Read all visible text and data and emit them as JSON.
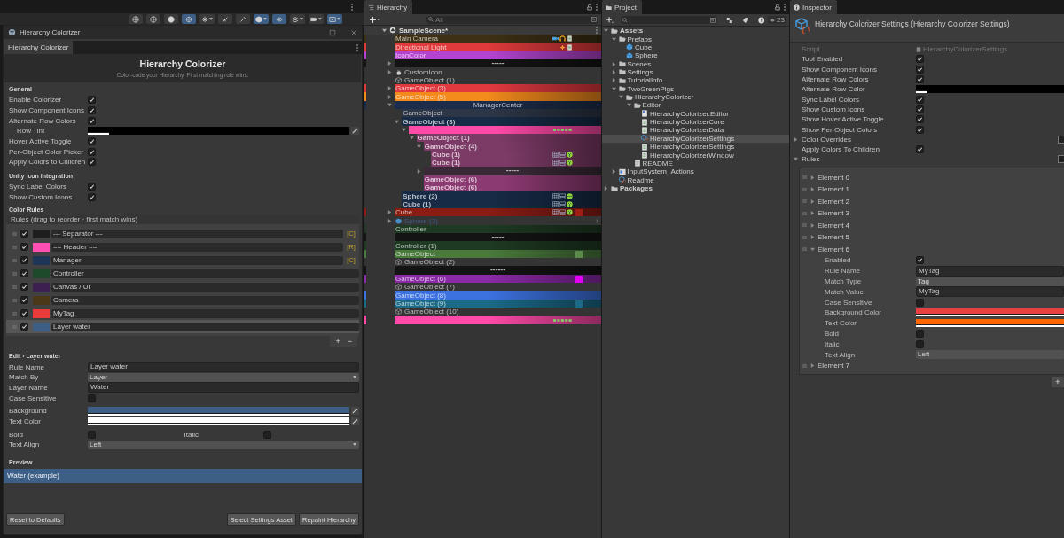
{
  "scene_toolbar": [
    {
      "kind": "wire",
      "selected": false
    },
    {
      "kind": "half",
      "selected": false
    },
    {
      "kind": "solid",
      "selected": false
    },
    {
      "kind": "ring",
      "selected": true
    },
    {
      "kind": "effects",
      "selected": false,
      "dropdown": true
    },
    {
      "kind": "hide",
      "selected": false
    },
    {
      "kind": "tool",
      "selected": false
    },
    {
      "kind": "gizmo",
      "selected": true,
      "dropdown": true
    },
    {
      "kind": "eye",
      "selected": true
    },
    {
      "kind": "layers",
      "selected": false,
      "dropdown": true
    },
    {
      "kind": "camera",
      "selected": false,
      "dropdown": true
    },
    {
      "kind": "overlay",
      "selected": true,
      "dropdown": true
    }
  ],
  "colorizer": {
    "window_title": "Hierarchy Colorizer",
    "tab": "Hierarchy Colorizer",
    "title": "Hierarchy Colorizer",
    "subtitle": "Color-code your Hierarchy. First matching rule wins.",
    "general": {
      "heading": "General",
      "options": [
        {
          "label": "Enable Colorizer",
          "kind": "toggle",
          "checked": true
        },
        {
          "label": "Show Component Icons",
          "kind": "toggle",
          "checked": true
        },
        {
          "label": "Alternate Row Colors",
          "kind": "toggle",
          "checked": true
        },
        {
          "label": "Row Tint",
          "kind": "color",
          "color": "#000000",
          "level": 0.08
        },
        {
          "label": "Hover Active Toggle",
          "kind": "toggle",
          "checked": true
        },
        {
          "label": "Per-Object Color Picker",
          "kind": "toggle",
          "checked": true
        },
        {
          "label": "Apply Colors to Children",
          "kind": "toggle",
          "checked": true
        }
      ]
    },
    "icon_integration": {
      "heading": "Unity Icon Integration",
      "options": [
        {
          "label": "Sync Label Colors",
          "kind": "toggle",
          "checked": true
        },
        {
          "label": "Show Custom Icons",
          "kind": "toggle",
          "checked": true
        }
      ]
    },
    "rules_heading": "Color Rules",
    "rules_header": "Rules  (drag to reorder · first match wins)",
    "rules": [
      {
        "enabled": true,
        "color": "#1e1e1e",
        "name": "--- Separator ---",
        "badge": "[C]",
        "selected": false
      },
      {
        "enabled": true,
        "color": "#ff4fb4",
        "name": "== Header ==",
        "badge": "[R]",
        "selected": false
      },
      {
        "enabled": true,
        "color": "#1f3558",
        "name": "Manager",
        "badge": "[C]",
        "selected": false
      },
      {
        "enabled": true,
        "color": "#1d4a2a",
        "name": "Controller",
        "selected": false
      },
      {
        "enabled": true,
        "color": "#3e1f52",
        "name": "Canvas / UI",
        "selected": false
      },
      {
        "enabled": true,
        "color": "#4a3818",
        "name": "Camera",
        "selected": false
      },
      {
        "enabled": true,
        "color": "#e83c3c",
        "name": "MyTag",
        "selected": false
      },
      {
        "enabled": true,
        "color": "#3d5f86",
        "name": "Layer water",
        "selected": true
      }
    ],
    "add": "+",
    "remove": "−",
    "edit": {
      "heading": "Edit › Layer water",
      "fields": [
        {
          "label": "Rule Name",
          "kind": "text",
          "value": "Layer water"
        },
        {
          "label": "Match By",
          "kind": "dropdown",
          "value": "Layer"
        },
        {
          "label": "Layer Name",
          "kind": "text",
          "value": "Water"
        },
        {
          "label": "Case Sensitive",
          "kind": "toggle",
          "checked": false
        },
        {
          "label": "Background",
          "kind": "color",
          "color": "#3d5f86",
          "level": 1
        },
        {
          "label": "Text Color",
          "kind": "color",
          "color": "#ffffff",
          "level": 1
        },
        {
          "kind": "toggles",
          "items": [
            {
              "label": "Bold",
              "checked": false
            },
            {
              "label": "Italic",
              "checked": false
            }
          ]
        },
        {
          "label": "Text Align",
          "kind": "dropdown",
          "value": "Left"
        }
      ]
    },
    "preview": {
      "heading": "Preview",
      "text": "Water  (example)"
    },
    "buttons": [
      "Reset to Defaults",
      "Select Settings Asset",
      "Repaint Hierarchy"
    ]
  },
  "hierarchy": {
    "tab": "Hierarchy",
    "search": {
      "placeholder": "All"
    },
    "scene": "SampleScene*",
    "rows": [
      {
        "kind": "rule",
        "label": "Main Camera",
        "color": "#3d3014",
        "components": [
          {
            "kind": "camera"
          },
          {
            "kind": "audio"
          },
          {
            "kind": "script"
          }
        ]
      },
      {
        "kind": "rule",
        "label": "Directional Light",
        "color": "#e03a3c",
        "components": [
          {
            "kind": "light"
          },
          {
            "kind": "script"
          }
        ]
      },
      {
        "kind": "rule",
        "label": "IconColor",
        "color": "#b444d0"
      },
      {
        "kind": "separator",
        "label": "-----",
        "color": "#141414",
        "expanded": false
      },
      {
        "kind": "custom",
        "label": "CustomIcon",
        "expanded": false
      },
      {
        "kind": "plain",
        "label": "GameObject (1)"
      },
      {
        "kind": "rule",
        "label": "GameObject (3)",
        "color": "#e2393f",
        "expanded": false
      },
      {
        "kind": "rule",
        "label": "GameObject (5)",
        "color": "#f28a1c",
        "expanded": false
      },
      {
        "kind": "header",
        "label": "ManagerCenter",
        "color": "#1b2d4b",
        "expanded": true,
        "children": [
          {
            "kind": "rule",
            "label": "GameObject",
            "color": "#2d3646"
          },
          {
            "kind": "rule",
            "label": "GameObject (3)",
            "color": "#172b46",
            "bold": true,
            "expanded": true,
            "children": [
              {
                "kind": "header",
                "color": "#ff4aa8",
                "dots": true,
                "expanded": true,
                "children": [
                  {
                    "kind": "rule",
                    "label": "GameObject (1)",
                    "color": "#7c3a66",
                    "bold": true,
                    "expanded": true,
                    "children": [
                      {
                        "kind": "rule",
                        "label": "GameObject (4)",
                        "color": "#7c3a66",
                        "bold": true,
                        "expanded": true,
                        "children": [
                          {
                            "kind": "rule",
                            "label": "Cube (1)",
                            "color": "#7c3a66",
                            "bold": true,
                            "components": [
                              {
                                "kind": "grid"
                              },
                              {
                                "kind": "mesh"
                              },
                              {
                                "kind": "collider"
                              }
                            ]
                          },
                          {
                            "kind": "rule",
                            "label": "Cube (1)",
                            "color": "#7c3a66",
                            "bold": true,
                            "components": [
                              {
                                "kind": "grid"
                              },
                              {
                                "kind": "mesh"
                              },
                              {
                                "kind": "collider"
                              }
                            ]
                          }
                        ]
                      },
                      {
                        "kind": "separator",
                        "label": "-----",
                        "color": "#3a2a38",
                        "expanded": false
                      },
                      {
                        "kind": "rule",
                        "label": "GameObject (6)",
                        "color": "#8c3a72",
                        "bold": true
                      },
                      {
                        "kind": "rule",
                        "label": "GameObject (6)",
                        "color": "#8c3a72",
                        "bold": true
                      }
                    ]
                  }
                ]
              }
            ]
          },
          {
            "kind": "rule",
            "label": "Sphere (2)",
            "color": "#172b46",
            "bold": true,
            "components": [
              {
                "kind": "grid"
              },
              {
                "kind": "mesh"
              },
              {
                "kind": "sphere"
              }
            ]
          },
          {
            "kind": "rule",
            "label": "Cube (1)",
            "color": "#172b46",
            "bold": true,
            "components": [
              {
                "kind": "grid"
              },
              {
                "kind": "mesh"
              },
              {
                "kind": "collider"
              }
            ]
          }
        ]
      },
      {
        "kind": "rule",
        "label": "Cube",
        "color": "#8a1c14",
        "expanded": false,
        "components": [
          {
            "kind": "grid"
          },
          {
            "kind": "mesh"
          },
          {
            "kind": "collider"
          }
        ],
        "swatch": {
          "color": "#a01c14"
        }
      },
      {
        "kind": "prefab",
        "label": "Sphere (3)",
        "expanded": false,
        "disabled": true
      },
      {
        "kind": "rule",
        "label": "Controller",
        "color": "#1e3a22"
      },
      {
        "kind": "separator",
        "label": "-----",
        "color": "#141414"
      },
      {
        "kind": "rule",
        "label": "Controller (1)",
        "color": "#1e3a22"
      },
      {
        "kind": "rule",
        "label": "GameObject",
        "color": "#4a7a3c",
        "swatch": {
          "color": "#5a8a4a"
        }
      },
      {
        "kind": "plain",
        "label": "GameObject (2)"
      },
      {
        "kind": "separator",
        "label": "------",
        "color": "#141414"
      },
      {
        "kind": "rule",
        "label": "GameObject (6)",
        "color": "#8a2aa6",
        "swatch": {
          "color": "#e400f4"
        }
      },
      {
        "kind": "plain",
        "label": "GameObject (7)"
      },
      {
        "kind": "rule",
        "label": "GameObject (8)",
        "color": "#3c72e0"
      },
      {
        "kind": "rule",
        "label": "GameObject (9)",
        "color": "#1a6a88",
        "swatch": {
          "color": "#1a6a88"
        }
      },
      {
        "kind": "plain",
        "label": "GameObject (10)"
      },
      {
        "kind": "header",
        "color": "#ff4aa8",
        "dots": true
      }
    ]
  },
  "project": {
    "tab": "Project",
    "count": "23",
    "tree": [
      {
        "kind": "folder",
        "label": "Assets",
        "bold": true,
        "selected": false,
        "expanded": true,
        "children": [
          {
            "kind": "folder",
            "label": "Prefabs",
            "selected": false,
            "expanded": true,
            "children": [
              {
                "kind": "prefab",
                "label": "Cube",
                "selected": false
              },
              {
                "kind": "prefab",
                "label": "Sphere",
                "selected": false
              }
            ]
          },
          {
            "kind": "folder",
            "label": "Scenes",
            "selected": false,
            "expanded": false
          },
          {
            "kind": "folder",
            "label": "Settings",
            "selected": false,
            "expanded": false
          },
          {
            "kind": "folder",
            "label": "TutorialInfo",
            "selected": false,
            "expanded": false
          },
          {
            "kind": "folder",
            "label": "TwoGreenPigs",
            "selected": false,
            "expanded": true,
            "children": [
              {
                "kind": "folder",
                "label": "HierarchyColorizer",
                "selected": false,
                "expanded": true,
                "children": [
                  {
                    "kind": "folder",
                    "label": "Editor",
                    "selected": false,
                    "expanded": true,
                    "children": [
                      {
                        "kind": "assembly",
                        "label": "HierarchyColorizer.Editor",
                        "selected": false
                      },
                      {
                        "kind": "script",
                        "label": "HierarchyColorizerCore",
                        "selected": false
                      },
                      {
                        "kind": "script",
                        "label": "HierarchyColorizerData",
                        "selected": false
                      },
                      {
                        "kind": "asset",
                        "label": "HierarchyColorizerSettings",
                        "selected": true
                      },
                      {
                        "kind": "script",
                        "label": "HierarchyColorizerSettings",
                        "selected": false
                      },
                      {
                        "kind": "script",
                        "label": "HierarchyColorizerWindow",
                        "selected": false
                      }
                    ]
                  },
                  {
                    "kind": "text",
                    "label": "README",
                    "selected": false
                  }
                ]
              }
            ]
          },
          {
            "kind": "input",
            "label": "InputSystem_Actions",
            "selected": false,
            "expanded": false
          },
          {
            "kind": "asset",
            "label": "Readme",
            "selected": false
          }
        ]
      },
      {
        "kind": "folder",
        "label": "Packages",
        "bold": true,
        "selected": false,
        "expanded": false
      }
    ]
  },
  "inspector": {
    "tab": "Inspector",
    "title": "Hierarchy Colorizer Settings (Hierarchy Colorizer Settings)",
    "fields": [
      {
        "label": "Script",
        "kind": "object",
        "value": "HierarchyColorizerSettings",
        "disabled": true
      },
      {
        "label": "Tool Enabled",
        "kind": "toggle",
        "checked": true
      },
      {
        "label": "Show Component Icons",
        "kind": "toggle",
        "checked": true
      },
      {
        "label": "Alternate Row Colors",
        "kind": "toggle",
        "checked": true
      },
      {
        "label": "Alternate Row Color",
        "kind": "color",
        "color": "#000000",
        "level": 0.08
      },
      {
        "label": "Sync Label Colors",
        "kind": "toggle",
        "checked": true
      },
      {
        "label": "Show Custom Icons",
        "kind": "toggle",
        "checked": true
      },
      {
        "label": "Show Hover Active Toggle",
        "kind": "toggle",
        "checked": true
      },
      {
        "label": "Show Per Object Colors",
        "kind": "toggle",
        "checked": true
      },
      {
        "label": "Color Overrides",
        "kind": "foldout",
        "expanded": false
      },
      {
        "label": "Apply Colors To Children",
        "kind": "toggle",
        "checked": true
      },
      {
        "label": "Rules",
        "kind": "foldout",
        "expanded": true
      }
    ],
    "elements": [
      {
        "label": "Element 0",
        "expanded": false
      },
      {
        "label": "Element 1",
        "expanded": false
      },
      {
        "label": "Element 2",
        "expanded": false
      },
      {
        "label": "Element 3",
        "expanded": false
      },
      {
        "label": "Element 4",
        "expanded": false
      },
      {
        "label": "Element 5",
        "expanded": false
      },
      {
        "label": "Element 6",
        "expanded": true,
        "fields": [
          {
            "label": "Enabled",
            "kind": "toggle",
            "checked": true
          },
          {
            "label": "Rule Name",
            "kind": "text",
            "value": "MyTag"
          },
          {
            "label": "Match Type",
            "kind": "dropdown",
            "value": "Tag"
          },
          {
            "label": "Match Value",
            "kind": "text",
            "value": "MyTag"
          },
          {
            "label": "Case Sensitive",
            "kind": "toggle",
            "checked": false
          },
          {
            "label": "Background Color",
            "kind": "color",
            "color": "#e8403f",
            "level": 1
          },
          {
            "label": "Text Color",
            "kind": "color",
            "color": "#ff6600",
            "level": 1
          },
          {
            "label": "Bold",
            "kind": "toggle",
            "checked": false
          },
          {
            "label": "Italic",
            "kind": "toggle",
            "checked": false
          },
          {
            "label": "Text Align",
            "kind": "dropdown",
            "value": "Left"
          }
        ]
      },
      {
        "label": "Element 7",
        "expanded": false
      }
    ],
    "add": "+"
  }
}
